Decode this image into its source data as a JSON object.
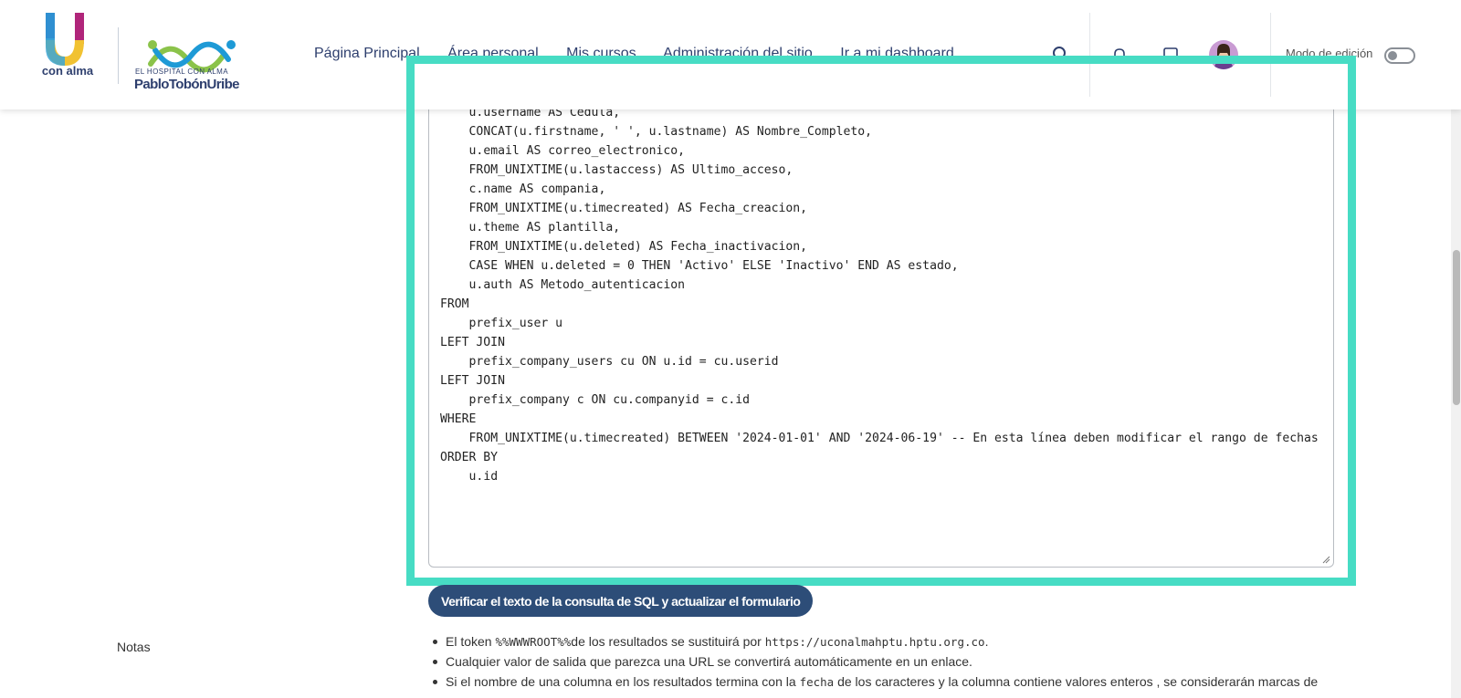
{
  "header": {
    "logo_text": "con alma",
    "hospital_tagline": "EL HOSPITAL CON ALMA",
    "hospital_name": "PabloTobónUribe",
    "nav": [
      {
        "label": "Página Principal"
      },
      {
        "label": "Área personal"
      },
      {
        "label": "Mis cursos"
      },
      {
        "label": "Administración del sitio"
      },
      {
        "label": "Ir a mi dashboard"
      }
    ],
    "edit_mode_label": "Modo de edición",
    "edit_mode_on": false
  },
  "editor": {
    "sql_text": "    u.username AS Cedula,\n    CONCAT(u.firstname, ' ', u.lastname) AS Nombre_Completo,\n    u.email AS correo_electronico,\n    FROM_UNIXTIME(u.lastaccess) AS Ultimo_acceso,\n    c.name AS compania,\n    FROM_UNIXTIME(u.timecreated) AS Fecha_creacion,\n    u.theme AS plantilla,\n    FROM_UNIXTIME(u.deleted) AS Fecha_inactivacion,\n    CASE WHEN u.deleted = 0 THEN 'Activo' ELSE 'Inactivo' END AS estado,\n    u.auth AS Metodo_autenticacion\nFROM\n    prefix_user u\nLEFT JOIN\n    prefix_company_users cu ON u.id = cu.userid\nLEFT JOIN\n    prefix_company c ON cu.companyid = c.id\nWHERE\n    FROM_UNIXTIME(u.timecreated) BETWEEN '2024-01-01' AND '2024-06-19' -- En esta línea deben modificar el rango de fechas\nORDER BY\n    u.id"
  },
  "verify_button_label": "Verificar el texto de la consulta de SQL y actualizar el formulario",
  "notes": {
    "label": "Notas",
    "items": [
      {
        "pre": "El token ",
        "code": "%%WWWROOT%%",
        "mid": "de los resultados se sustituirá por ",
        "code2": "https://uconalmahptu.hptu.org.co",
        "post": "."
      },
      {
        "text": "Cualquier valor de salida que parezca una URL se convertirá automáticamente en un enlace."
      },
      {
        "pre": "Si el nombre de una columna en los resultados termina con la ",
        "code": "fecha",
        "post": " de los caracteres y la columna contiene valores enteros , se considerarán marcas de"
      }
    ]
  },
  "colors": {
    "highlight": "#47dcc4",
    "nav_text": "#2e3f6e",
    "button_bg": "#2d4d78"
  }
}
